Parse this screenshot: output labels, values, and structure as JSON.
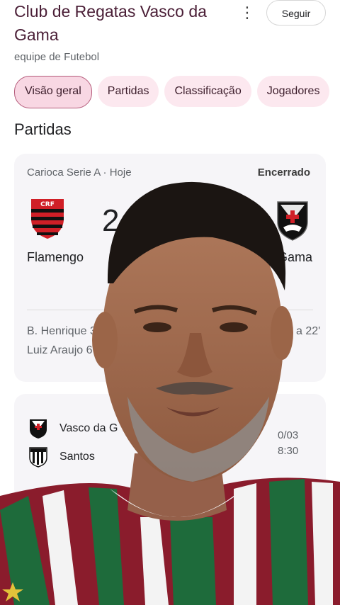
{
  "header": {
    "title": "Club de Regatas Vasco da Gama",
    "subtitle": "equipe de Futebol",
    "follow_label": "Seguir",
    "more_icon": "⋮"
  },
  "chips": [
    "Visão geral",
    "Partidas",
    "Classificação",
    "Jogadores"
  ],
  "section_title": "Partidas",
  "match1": {
    "meta": "Carioca Serie A · Hoje",
    "status": "Encerrado",
    "home_team": "Flamengo",
    "away_team": "Gama",
    "home_score": "2",
    "scorers": [
      "B. Henrique 36",
      "Luiz Araujo 6",
      "a 22'"
    ]
  },
  "match2": {
    "home_team": "Vasco da G",
    "away_team": "Santos",
    "date": "0/03",
    "time": "8:30"
  },
  "colors": {
    "flamengo_red": "#d01f27",
    "flamengo_black": "#111111",
    "shirt_green": "#1e6b3b",
    "shirt_maroon": "#8a1c2c"
  }
}
